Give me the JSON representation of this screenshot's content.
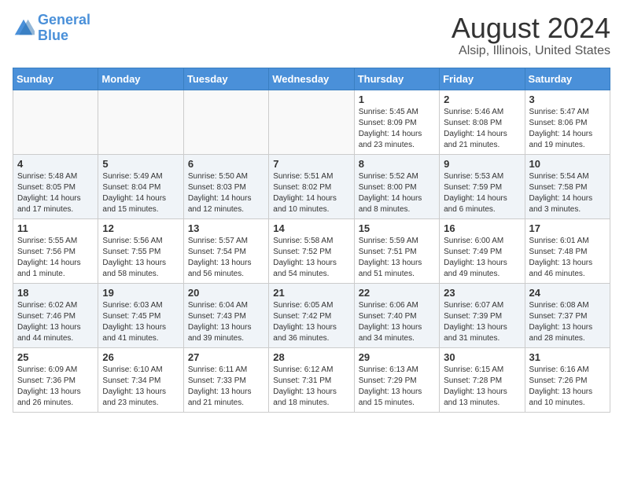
{
  "logo": {
    "text_general": "General",
    "text_blue": "Blue"
  },
  "header": {
    "month": "August 2024",
    "location": "Alsip, Illinois, United States"
  },
  "weekdays": [
    "Sunday",
    "Monday",
    "Tuesday",
    "Wednesday",
    "Thursday",
    "Friday",
    "Saturday"
  ],
  "weeks": [
    [
      {
        "day": "",
        "info": ""
      },
      {
        "day": "",
        "info": ""
      },
      {
        "day": "",
        "info": ""
      },
      {
        "day": "",
        "info": ""
      },
      {
        "day": "1",
        "info": "Sunrise: 5:45 AM\nSunset: 8:09 PM\nDaylight: 14 hours\nand 23 minutes."
      },
      {
        "day": "2",
        "info": "Sunrise: 5:46 AM\nSunset: 8:08 PM\nDaylight: 14 hours\nand 21 minutes."
      },
      {
        "day": "3",
        "info": "Sunrise: 5:47 AM\nSunset: 8:06 PM\nDaylight: 14 hours\nand 19 minutes."
      }
    ],
    [
      {
        "day": "4",
        "info": "Sunrise: 5:48 AM\nSunset: 8:05 PM\nDaylight: 14 hours\nand 17 minutes."
      },
      {
        "day": "5",
        "info": "Sunrise: 5:49 AM\nSunset: 8:04 PM\nDaylight: 14 hours\nand 15 minutes."
      },
      {
        "day": "6",
        "info": "Sunrise: 5:50 AM\nSunset: 8:03 PM\nDaylight: 14 hours\nand 12 minutes."
      },
      {
        "day": "7",
        "info": "Sunrise: 5:51 AM\nSunset: 8:02 PM\nDaylight: 14 hours\nand 10 minutes."
      },
      {
        "day": "8",
        "info": "Sunrise: 5:52 AM\nSunset: 8:00 PM\nDaylight: 14 hours\nand 8 minutes."
      },
      {
        "day": "9",
        "info": "Sunrise: 5:53 AM\nSunset: 7:59 PM\nDaylight: 14 hours\nand 6 minutes."
      },
      {
        "day": "10",
        "info": "Sunrise: 5:54 AM\nSunset: 7:58 PM\nDaylight: 14 hours\nand 3 minutes."
      }
    ],
    [
      {
        "day": "11",
        "info": "Sunrise: 5:55 AM\nSunset: 7:56 PM\nDaylight: 14 hours\nand 1 minute."
      },
      {
        "day": "12",
        "info": "Sunrise: 5:56 AM\nSunset: 7:55 PM\nDaylight: 13 hours\nand 58 minutes."
      },
      {
        "day": "13",
        "info": "Sunrise: 5:57 AM\nSunset: 7:54 PM\nDaylight: 13 hours\nand 56 minutes."
      },
      {
        "day": "14",
        "info": "Sunrise: 5:58 AM\nSunset: 7:52 PM\nDaylight: 13 hours\nand 54 minutes."
      },
      {
        "day": "15",
        "info": "Sunrise: 5:59 AM\nSunset: 7:51 PM\nDaylight: 13 hours\nand 51 minutes."
      },
      {
        "day": "16",
        "info": "Sunrise: 6:00 AM\nSunset: 7:49 PM\nDaylight: 13 hours\nand 49 minutes."
      },
      {
        "day": "17",
        "info": "Sunrise: 6:01 AM\nSunset: 7:48 PM\nDaylight: 13 hours\nand 46 minutes."
      }
    ],
    [
      {
        "day": "18",
        "info": "Sunrise: 6:02 AM\nSunset: 7:46 PM\nDaylight: 13 hours\nand 44 minutes."
      },
      {
        "day": "19",
        "info": "Sunrise: 6:03 AM\nSunset: 7:45 PM\nDaylight: 13 hours\nand 41 minutes."
      },
      {
        "day": "20",
        "info": "Sunrise: 6:04 AM\nSunset: 7:43 PM\nDaylight: 13 hours\nand 39 minutes."
      },
      {
        "day": "21",
        "info": "Sunrise: 6:05 AM\nSunset: 7:42 PM\nDaylight: 13 hours\nand 36 minutes."
      },
      {
        "day": "22",
        "info": "Sunrise: 6:06 AM\nSunset: 7:40 PM\nDaylight: 13 hours\nand 34 minutes."
      },
      {
        "day": "23",
        "info": "Sunrise: 6:07 AM\nSunset: 7:39 PM\nDaylight: 13 hours\nand 31 minutes."
      },
      {
        "day": "24",
        "info": "Sunrise: 6:08 AM\nSunset: 7:37 PM\nDaylight: 13 hours\nand 28 minutes."
      }
    ],
    [
      {
        "day": "25",
        "info": "Sunrise: 6:09 AM\nSunset: 7:36 PM\nDaylight: 13 hours\nand 26 minutes."
      },
      {
        "day": "26",
        "info": "Sunrise: 6:10 AM\nSunset: 7:34 PM\nDaylight: 13 hours\nand 23 minutes."
      },
      {
        "day": "27",
        "info": "Sunrise: 6:11 AM\nSunset: 7:33 PM\nDaylight: 13 hours\nand 21 minutes."
      },
      {
        "day": "28",
        "info": "Sunrise: 6:12 AM\nSunset: 7:31 PM\nDaylight: 13 hours\nand 18 minutes."
      },
      {
        "day": "29",
        "info": "Sunrise: 6:13 AM\nSunset: 7:29 PM\nDaylight: 13 hours\nand 15 minutes."
      },
      {
        "day": "30",
        "info": "Sunrise: 6:15 AM\nSunset: 7:28 PM\nDaylight: 13 hours\nand 13 minutes."
      },
      {
        "day": "31",
        "info": "Sunrise: 6:16 AM\nSunset: 7:26 PM\nDaylight: 13 hours\nand 10 minutes."
      }
    ]
  ]
}
